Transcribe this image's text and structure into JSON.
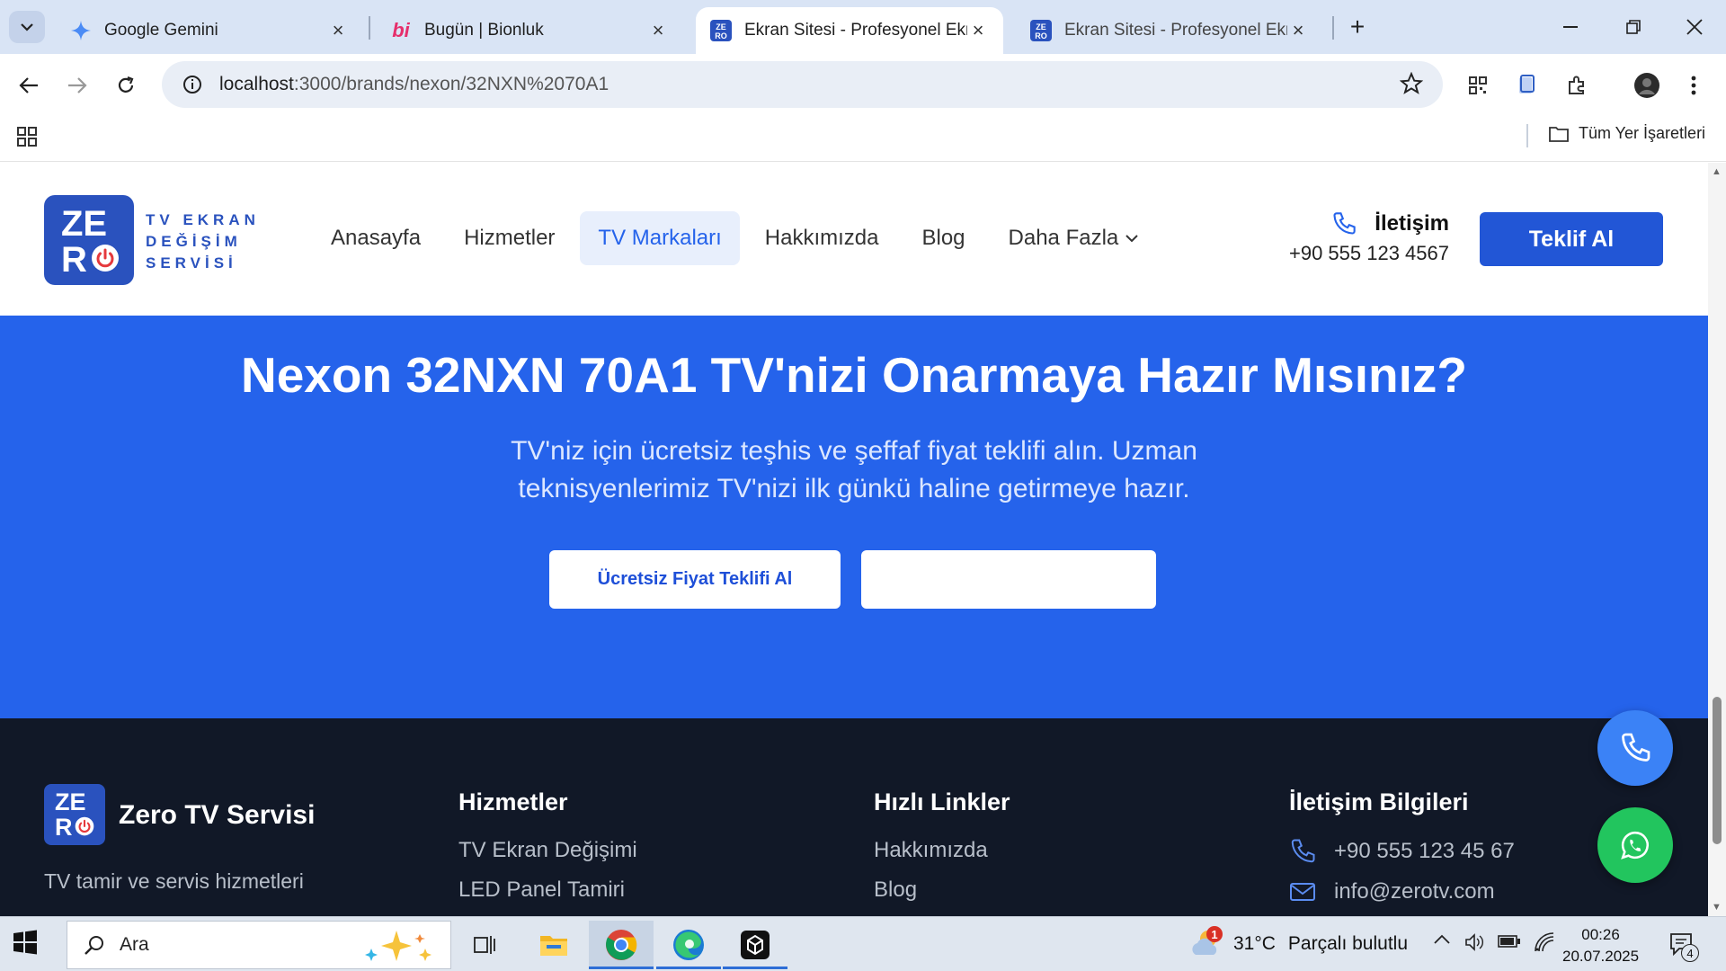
{
  "browser": {
    "tabs": [
      {
        "title": "Google Gemini",
        "active": false
      },
      {
        "title": "Bugün | Bionluk",
        "active": false
      },
      {
        "title": "Ekran Sitesi - Profesyonel Ekran",
        "active": true
      },
      {
        "title": "Ekran Sitesi - Profesyonel Ekran",
        "active": false
      }
    ],
    "url_host": "localhost",
    "url_path": ":3000/brands/nexon/32NXN%2070A1",
    "bookmarks_all": "Tüm Yer İşaretleri"
  },
  "site": {
    "logo": {
      "z": "ZE",
      "r": "R",
      "line1": "TV EKRAN",
      "line2": "DEĞİŞİM",
      "line3": "SERVİSİ"
    },
    "nav": [
      {
        "label": "Anasayfa",
        "active": false
      },
      {
        "label": "Hizmetler",
        "active": false
      },
      {
        "label": "TV Markaları",
        "active": true
      },
      {
        "label": "Hakkımızda",
        "active": false
      },
      {
        "label": "Blog",
        "active": false
      },
      {
        "label": "Daha Fazla",
        "active": false
      }
    ],
    "contact_label": "İletişim",
    "contact_phone": "+90 555 123 4567",
    "cta": "Teklif Al"
  },
  "hero": {
    "title": "Nexon 32NXN 70A1 TV'nizi Onarmaya Hazır Mısınız?",
    "subtitle": "TV'niz için ücretsiz teşhis ve şeffaf fiyat teklifi alın. Uzman teknisyenlerimiz TV'nizi ilk günkü haline getirmeye hazır.",
    "primary_button": "Ücretsiz Fiyat Teklifi Al",
    "secondary_button": ""
  },
  "footer": {
    "brand": "Zero TV Servisi",
    "tagline": "TV tamir ve servis hizmetleri",
    "services_title": "Hizmetler",
    "services": [
      "TV Ekran Değişimi",
      "LED Panel Tamiri"
    ],
    "links_title": "Hızlı Linkler",
    "links": [
      "Hakkımızda",
      "Blog"
    ],
    "contact_title": "İletişim Bilgileri",
    "phone": "+90 555 123 45 67",
    "email": "info@zerotv.com"
  },
  "taskbar": {
    "search_placeholder": "Ara",
    "weather_temp": "31°C",
    "weather_desc": "Parçalı bulutlu",
    "weather_badge": "1",
    "time": "00:26",
    "date": "20.07.2025",
    "notification_count": "4"
  },
  "colors": {
    "brand_blue": "#2563eb",
    "logo_blue": "#2a52be",
    "footer_bg": "#111827",
    "whatsapp_green": "#22c55e"
  }
}
